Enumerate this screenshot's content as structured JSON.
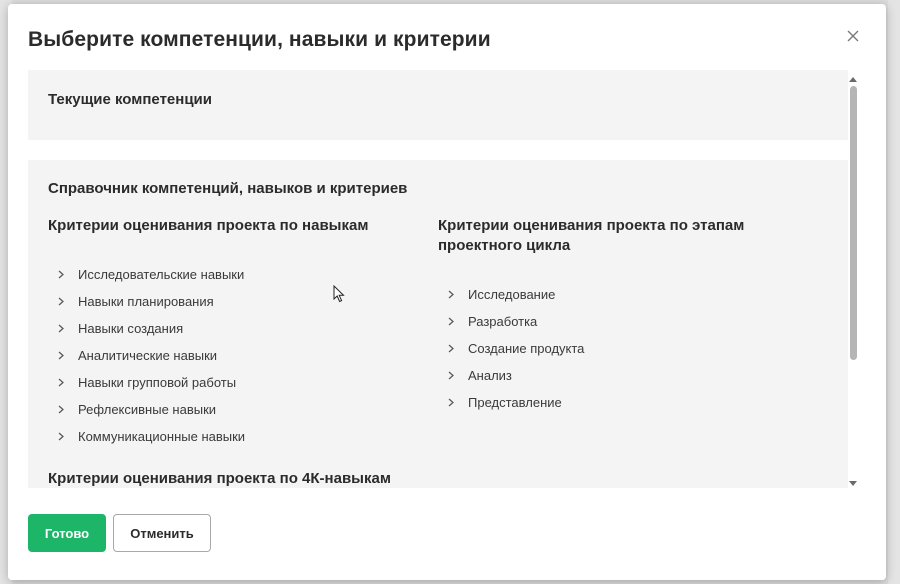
{
  "dialog": {
    "title": "Выберите компетенции, навыки и критерии",
    "close_icon": "close-icon"
  },
  "current_section": {
    "title": "Текущие компетенции"
  },
  "reference_section": {
    "title": "Справочник компетенций, навыков и критериев",
    "left_column": {
      "heading": "Критерии оценивания проекта по навыкам",
      "items": [
        {
          "label": "Исследовательские навыки"
        },
        {
          "label": "Навыки планирования"
        },
        {
          "label": "Навыки создания"
        },
        {
          "label": "Аналитические навыки"
        },
        {
          "label": "Навыки групповой работы"
        },
        {
          "label": "Рефлексивные навыки"
        },
        {
          "label": "Коммуникационные навыки"
        }
      ]
    },
    "right_column": {
      "heading": "Критерии оценивания проекта по этапам проектного цикла",
      "items": [
        {
          "label": "Исследование"
        },
        {
          "label": "Разработка"
        },
        {
          "label": "Создание продукта"
        },
        {
          "label": "Анализ"
        },
        {
          "label": "Представление"
        }
      ]
    },
    "next_heading": "Критерии оценивания проекта по 4К-навыкам"
  },
  "footer": {
    "done_label": "Готово",
    "cancel_label": "Отменить"
  },
  "colors": {
    "primary": "#1db567",
    "card_background": "#f4f4f4",
    "text": "#2b2b2b"
  }
}
